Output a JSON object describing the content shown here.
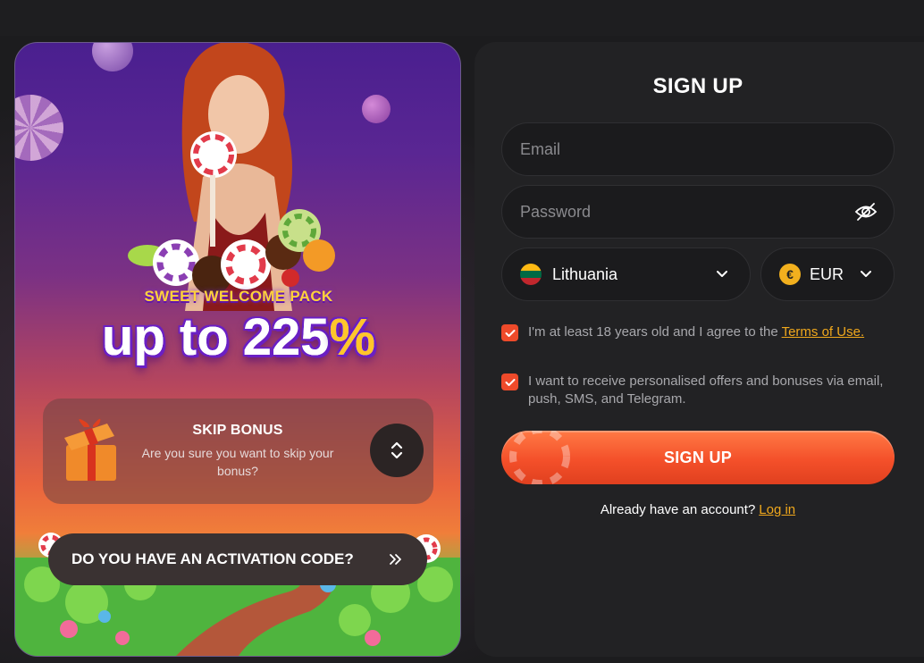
{
  "promo": {
    "subtitle": "SWEET WELCOME PACK",
    "amount_prefix": "up to 225",
    "amount_suffix": "%",
    "skip": {
      "title": "SKIP BONUS",
      "text": "Are you sure you want to skip your bonus?"
    },
    "activation_label": "DO YOU HAVE AN ACTIVATION CODE?"
  },
  "form": {
    "title": "SIGN UP",
    "email_placeholder": "Email",
    "password_placeholder": "Password",
    "country": "Lithuania",
    "currency": "EUR",
    "currency_symbol": "€",
    "age_text": "I'm at least 18 years old and I agree to the ",
    "terms_link": "Terms of Use.",
    "offers_text": "I want to receive personalised offers and bonuses via email, push, SMS, and Telegram.",
    "age_checked": true,
    "offers_checked": true,
    "submit_label": "SIGN UP",
    "login_prompt": "Already have an account?",
    "login_link": "Log in"
  },
  "colors": {
    "accent": "#f4502a",
    "link": "#f0a81c",
    "panel_bg": "#222224"
  },
  "icons": [
    "gift-icon",
    "chevron-up-down-icon",
    "double-chevron-right-icon",
    "eye-off-icon",
    "chevron-down-icon",
    "lithuania-flag-icon",
    "euro-icon",
    "checkmark-icon"
  ]
}
